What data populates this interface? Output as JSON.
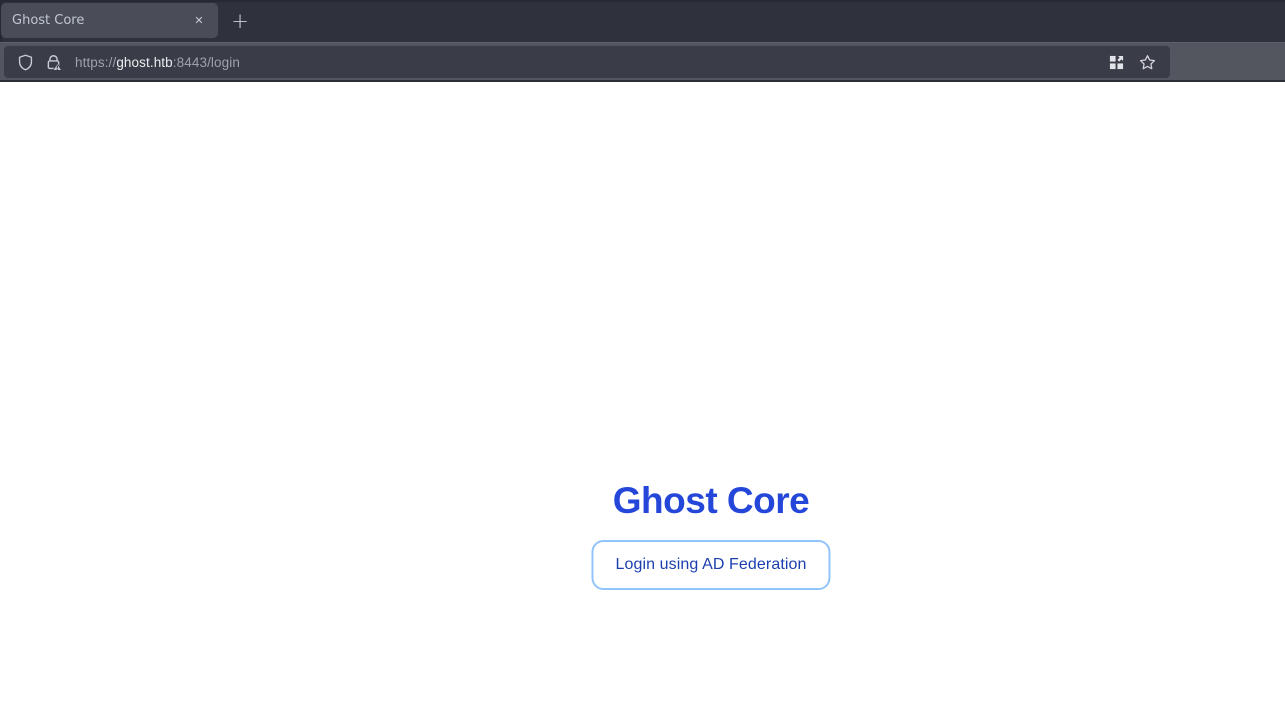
{
  "browser": {
    "tab": {
      "title": "Ghost Core",
      "close_glyph": "✕"
    },
    "new_tab_glyph": "+",
    "url": {
      "scheme": "https://",
      "domain": "ghost.htb",
      "path": ":8443/login"
    },
    "icons": {
      "shield": "tracking-protection-shield",
      "lock": "connection-not-secure-lock-warning",
      "grid": "page-action-grid-arrow",
      "star": "bookmark-star"
    },
    "colors": {
      "tabbar_bg": "#2f323c",
      "tab_bg": "#4a4d57",
      "toolbar_bg": "#54565f",
      "urlbar_bg": "#3a3d47"
    }
  },
  "page": {
    "title": "Ghost Core",
    "login_button_label": "Login using AD Federation",
    "colors": {
      "title_blue": "#2447d9",
      "button_border": "#92c4fc",
      "button_text": "#1c3faf"
    }
  }
}
